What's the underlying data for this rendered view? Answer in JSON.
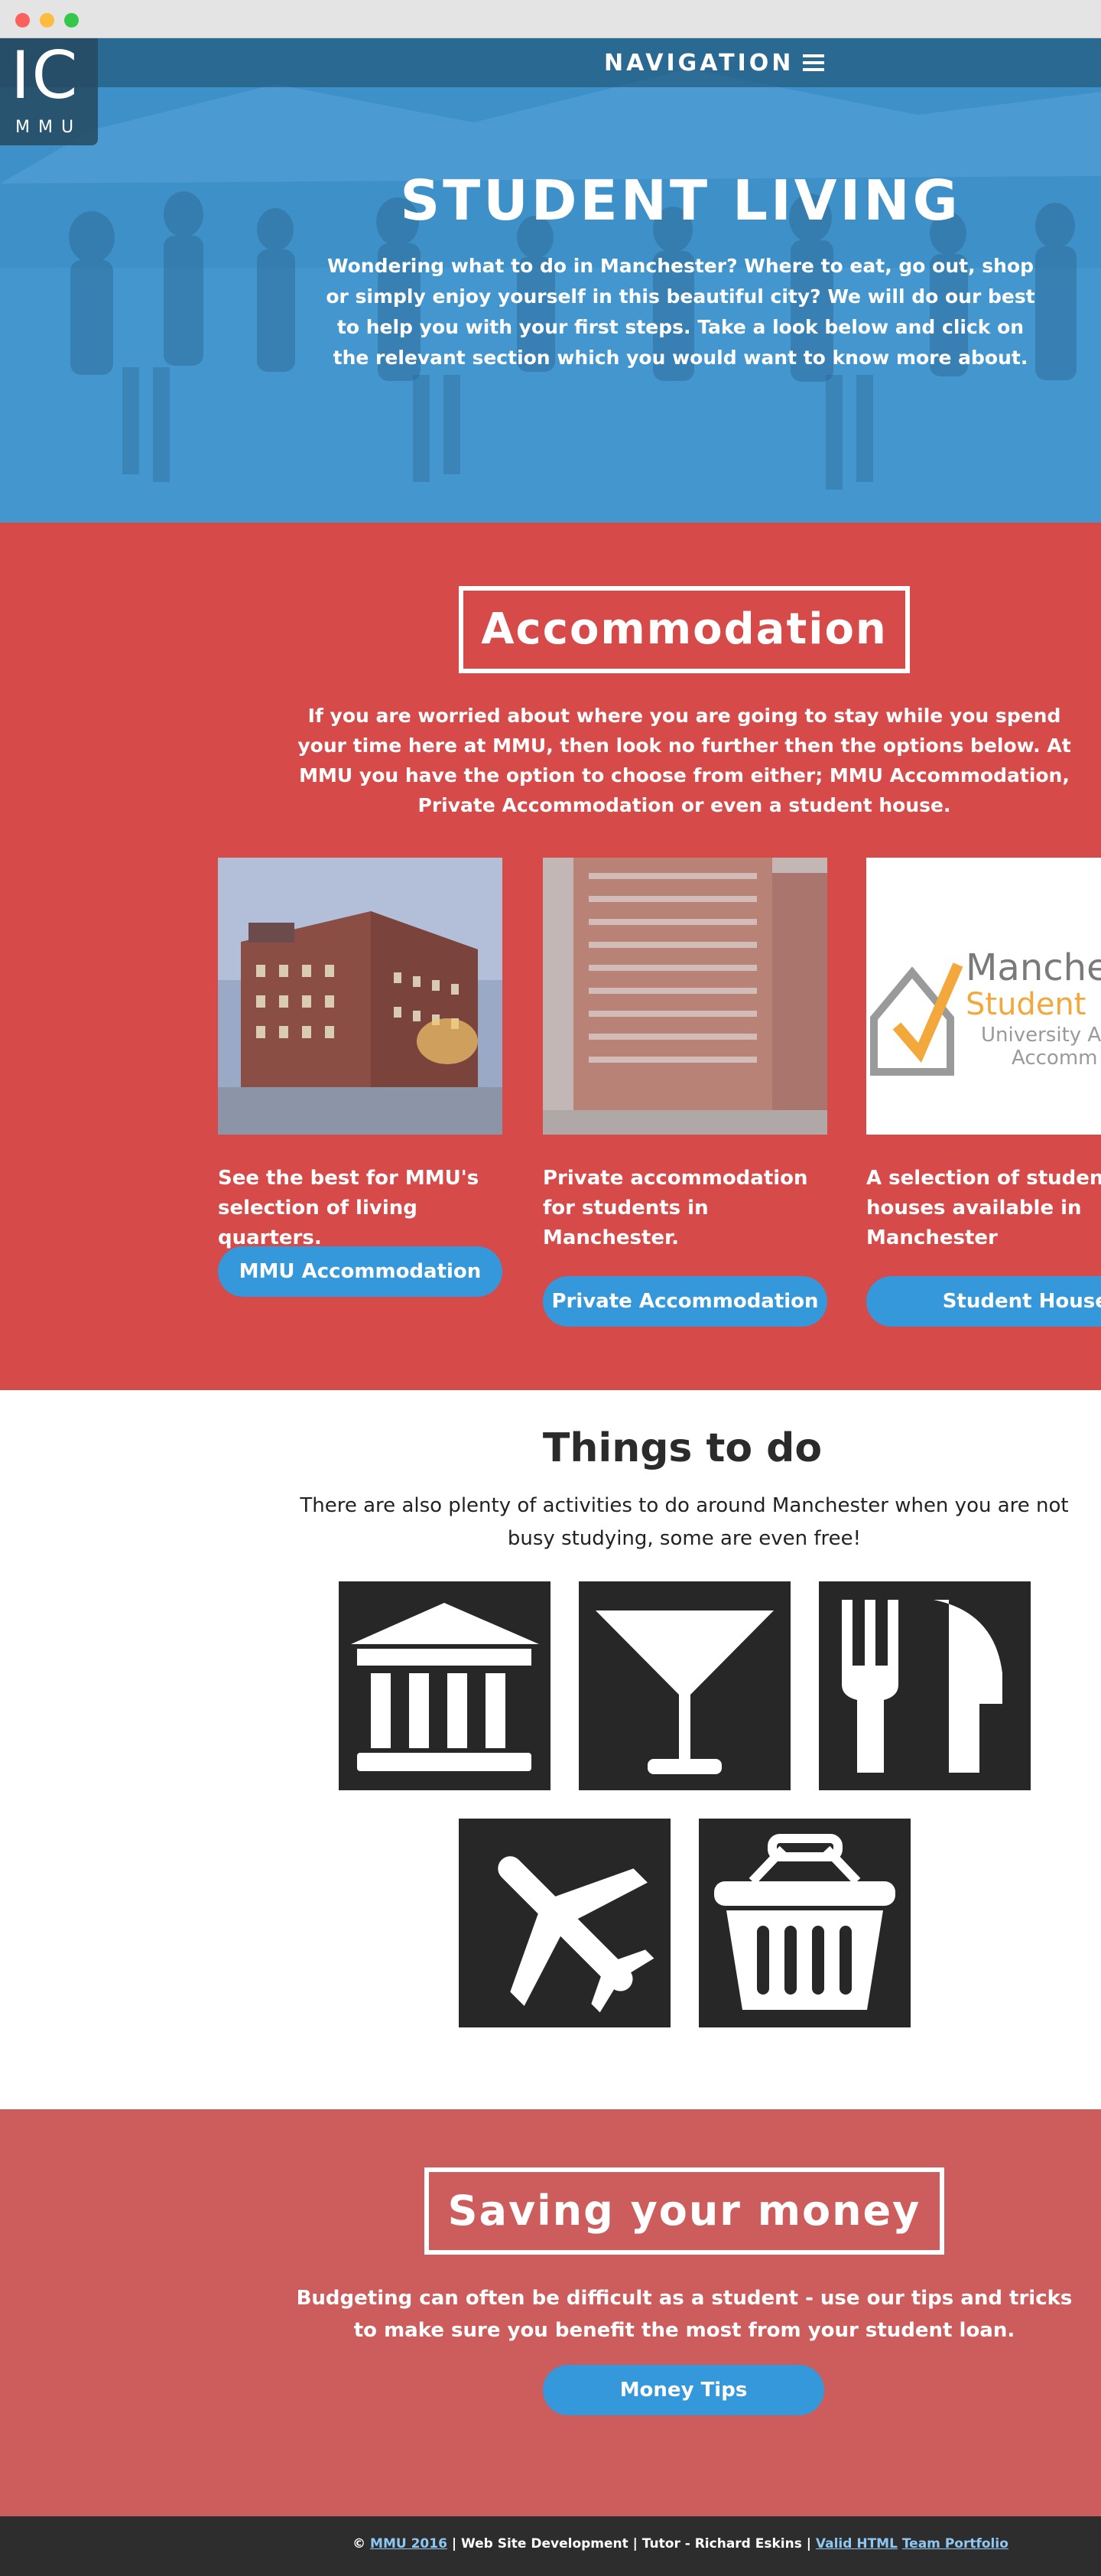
{
  "page": {
    "colors": {
      "hero_blue": "#3f92c9",
      "accent_red": "#d64a49",
      "saving_red": "#cd5c5c",
      "button_blue": "#3498db",
      "tile_dark": "#272727",
      "footer_dark": "#2d2d2d"
    }
  },
  "header": {
    "logo_main": "IC",
    "logo_sub": "MMU",
    "nav_label": "NAVIGATION",
    "nav_icon": "hamburger-menu-icon"
  },
  "hero": {
    "title": "STUDENT LIVING",
    "text": "Wondering what to do in Manchester? Where to eat, go out, shop or simply enjoy yourself in this beautiful city? We will do our best to help you with your first steps. Take a look below and click on the relevant section which you would want to know more about."
  },
  "accommodation": {
    "title": "Accommodation",
    "text": "If you are worried about where you are going to stay while you spend your time here at MMU, then look no further then the options below. At MMU you have the option to choose from either; MMU Accommodation, Private Accommodation or even a student house.",
    "cards": [
      {
        "text": "See the best for MMU's selection of living quarters.",
        "button": "MMU Accommodation"
      },
      {
        "text": "Private accommodation for students in Manchester.",
        "button": "Private Accommodation"
      },
      {
        "text": "A selection of student houses available in Manchester",
        "button": "Student Houses",
        "image_text": [
          "Manche",
          "Student",
          "University A",
          "Accomm"
        ]
      }
    ]
  },
  "things": {
    "title": "Things to do",
    "text": "There are also plenty of activities to do around Manchester when you are not busy studying, some are even free!",
    "tiles": [
      {
        "icon": "museum-icon"
      },
      {
        "icon": "cocktail-glass-icon"
      },
      {
        "icon": "fork-knife-icon"
      },
      {
        "icon": "airplane-icon"
      },
      {
        "icon": "shopping-basket-icon"
      }
    ]
  },
  "saving": {
    "title": "Saving your money",
    "text": "Budgeting can often be difficult as a student - use our tips and tricks to make sure you benefit the most from your student loan.",
    "button": "Money Tips"
  },
  "footer": {
    "copyright_symbol": "©",
    "copyright_link": "MMU 2016",
    "middle": " | Web Site Development | Tutor - Richard Eskins | ",
    "valid_link": "Valid HTML",
    "team_link": "Team Portfolio"
  }
}
